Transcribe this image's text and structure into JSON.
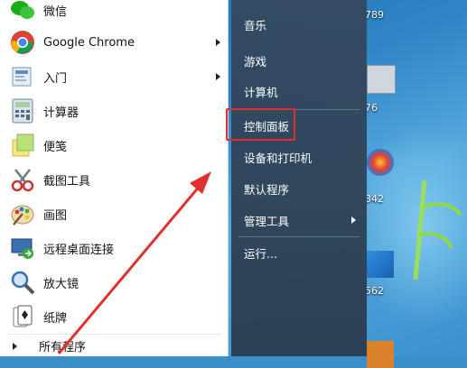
{
  "start_menu": {
    "programs": [
      {
        "label": "微信",
        "icon": "wechat-icon",
        "has_submenu": false
      },
      {
        "label": "Google Chrome",
        "icon": "chrome-icon",
        "has_submenu": true
      },
      {
        "label": "入门",
        "icon": "getting-started-icon",
        "has_submenu": true
      },
      {
        "label": "计算器",
        "icon": "calculator-icon",
        "has_submenu": false
      },
      {
        "label": "便笺",
        "icon": "sticky-notes-icon",
        "has_submenu": false
      },
      {
        "label": "截图工具",
        "icon": "snipping-tool-icon",
        "has_submenu": false
      },
      {
        "label": "画图",
        "icon": "paint-icon",
        "has_submenu": false
      },
      {
        "label": "远程桌面连接",
        "icon": "remote-desktop-icon",
        "has_submenu": false
      },
      {
        "label": "放大镜",
        "icon": "magnifier-icon",
        "has_submenu": false
      },
      {
        "label": "纸牌",
        "icon": "solitaire-icon",
        "has_submenu": false
      }
    ],
    "all_programs_label": "所有程序",
    "right_items": [
      {
        "label": "音乐",
        "has_submenu": false
      },
      {
        "label": "游戏",
        "has_submenu": false
      },
      {
        "label": "计算机",
        "has_submenu": false
      },
      {
        "label": "控制面板",
        "has_submenu": false,
        "highlighted": true
      },
      {
        "label": "设备和打印机",
        "has_submenu": false
      },
      {
        "label": "默认程序",
        "has_submenu": false
      },
      {
        "label": "管理工具",
        "has_submenu": true
      },
      {
        "label": "运行...",
        "has_submenu": false
      }
    ]
  },
  "desktop": {
    "icon_labels": [
      "789",
      "76",
      "342",
      "562"
    ]
  },
  "annotation": {
    "color": "#e0302c"
  }
}
